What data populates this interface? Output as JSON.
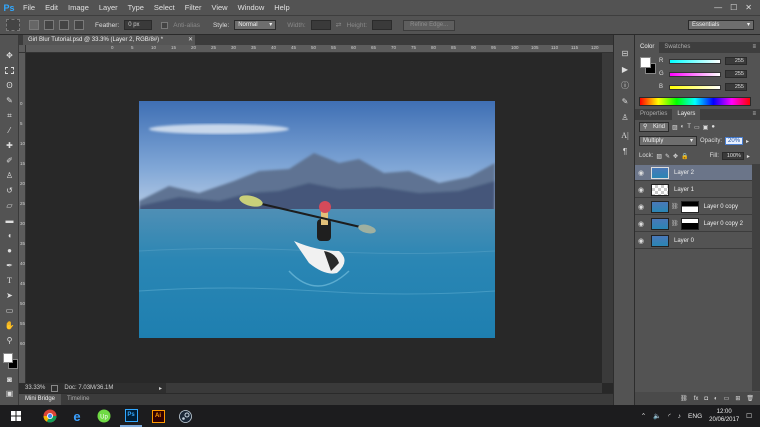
{
  "app": {
    "logo": "Ps"
  },
  "menu": {
    "items": [
      "File",
      "Edit",
      "Image",
      "Layer",
      "Type",
      "Select",
      "Filter",
      "View",
      "Window",
      "Help"
    ]
  },
  "window_controls": {
    "minimize": "—",
    "maximize": "☐",
    "close": "✕"
  },
  "options_bar": {
    "feather_label": "Feather:",
    "feather_value": "0 px",
    "anti_alias_label": "Anti-alias",
    "style_label": "Style:",
    "style_value": "Normal",
    "width_label": "Width:",
    "height_label": "Height:",
    "refine_edge_label": "Refine Edge...",
    "workspace_value": "Essentials"
  },
  "document": {
    "tab_title": "Girl Blur Tutorial.psd @ 33.3% (Layer 2, RGB/8#) *",
    "close_glyph": "✕"
  },
  "ruler": {
    "top_labels": [
      "0",
      "5",
      "10",
      "15",
      "20",
      "25",
      "30",
      "35",
      "40",
      "45",
      "50",
      "55",
      "60",
      "65",
      "70",
      "75",
      "80",
      "85",
      "90",
      "95",
      "100",
      "105",
      "110",
      "115",
      "120"
    ],
    "left_labels": [
      "0",
      "5",
      "10",
      "15",
      "20",
      "25",
      "30",
      "35",
      "40",
      "45",
      "50",
      "55",
      "60"
    ]
  },
  "status": {
    "zoom": "33.33%",
    "doc_info": "Doc: 7.03M/36.1M"
  },
  "bottom_tabs": [
    {
      "label": "Mini Bridge",
      "active": true
    },
    {
      "label": "Timeline",
      "active": false
    }
  ],
  "color_panel": {
    "tabs": [
      {
        "label": "Color",
        "active": true
      },
      {
        "label": "Swatches",
        "active": false
      }
    ],
    "r_label": "R",
    "r_value": "255",
    "g_label": "G",
    "g_value": "255",
    "b_label": "B",
    "b_value": "255"
  },
  "layers_panel": {
    "tabs": [
      {
        "label": "Properties",
        "active": false
      },
      {
        "label": "Layers",
        "active": true
      }
    ],
    "filter_kind": "Kind",
    "blend_mode": "Multiply",
    "opacity_label": "Opacity:",
    "opacity_value": "20%",
    "lock_label": "Lock:",
    "fill_label": "Fill:",
    "fill_value": "100%",
    "layers": [
      {
        "name": "Layer 2",
        "selected": true
      },
      {
        "name": "Layer 1",
        "selected": false
      },
      {
        "name": "Layer 0 copy",
        "selected": false
      },
      {
        "name": "Layer 0 copy 2",
        "selected": false
      },
      {
        "name": "Layer 0",
        "selected": false
      }
    ],
    "footer_icons": [
      "link-icon",
      "fx-icon",
      "mask-icon",
      "adjustment-icon",
      "group-icon",
      "new-layer-icon",
      "trash-icon"
    ]
  },
  "taskbar": {
    "apps": [
      "windows-start",
      "chrome",
      "edge",
      "upwork",
      "photoshop",
      "illustrator",
      "steam"
    ],
    "language": "ENG",
    "time": "12:00",
    "date": "20/06/2017"
  }
}
